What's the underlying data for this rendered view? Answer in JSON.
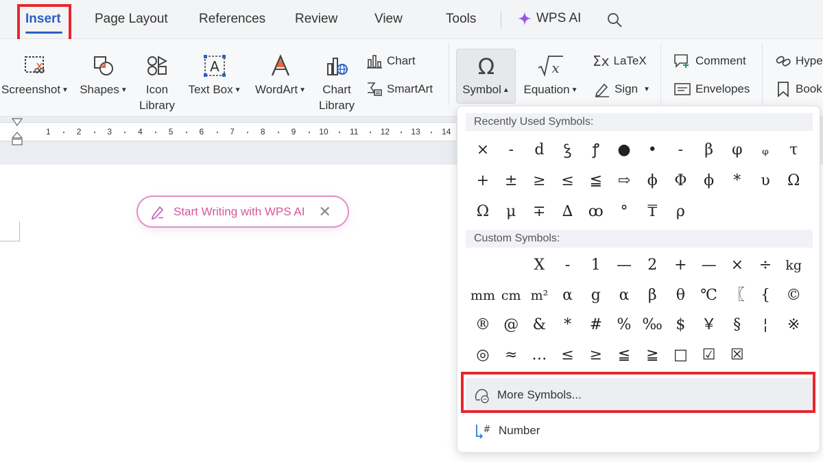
{
  "tabs": {
    "insert": "Insert",
    "page_layout": "Page Layout",
    "references": "References",
    "review": "Review",
    "view": "View",
    "tools": "Tools",
    "wps_ai": "WPS AI"
  },
  "ribbon": {
    "screenshot": "Screenshot",
    "shapes": "Shapes",
    "icon_library_1": "Icon",
    "icon_library_2": "Library",
    "text_box": "Text Box",
    "wordart": "WordArt",
    "chart_library_1": "Chart",
    "chart_library_2": "Library",
    "chart": "Chart",
    "smartart": "SmartArt",
    "symbol": "Symbol",
    "equation": "Equation",
    "latex": "LaTeX",
    "sign": "Sign",
    "comment": "Comment",
    "envelopes": "Envelopes",
    "hyperlink": "Hype",
    "bookmark": "Book"
  },
  "ruler": [
    "1",
    "2",
    "3",
    "4",
    "5",
    "6",
    "7",
    "8",
    "9",
    "10",
    "11",
    "12",
    "13",
    "14"
  ],
  "ai_prompt": {
    "label": "Start Writing with WPS AI"
  },
  "symbol_menu": {
    "recent_header": "Recently Used Symbols:",
    "recent": [
      "×",
      "-",
      "d",
      "ꝣ",
      "ꝭ",
      "●",
      "•",
      "-",
      "β",
      "φ",
      "ᵩ",
      "τ",
      "+",
      "±",
      "≥",
      "≤",
      "≦",
      "⇨",
      "ϕ",
      "Φ",
      "ϕ",
      "*",
      "υ",
      "Ω",
      "Ω",
      "μ",
      "∓",
      "∆",
      "ꝏ",
      "°",
      "₸",
      "ρ"
    ],
    "custom_header": "Custom Symbols:",
    "custom": [
      "X",
      "-",
      "1",
      "—",
      "2",
      "+",
      "—",
      "×",
      "÷",
      "kg",
      "mm",
      "cm",
      "m²",
      "α",
      "g",
      "α",
      "β",
      "θ",
      "℃",
      "〖",
      "{",
      "©",
      "®",
      "@",
      "&",
      "*",
      "#",
      "%",
      "‰",
      "$",
      "￥",
      "§",
      "¦",
      "※",
      "◎",
      "≈",
      "…",
      "≤",
      "≥",
      "≦",
      "≧",
      "□",
      "☑",
      "☒"
    ],
    "more_symbols": "More Symbols...",
    "number": "Number"
  },
  "colors": {
    "accent": "#2b5fc4",
    "highlight_red": "#e8262d",
    "ai_pink": "#d6569e"
  }
}
